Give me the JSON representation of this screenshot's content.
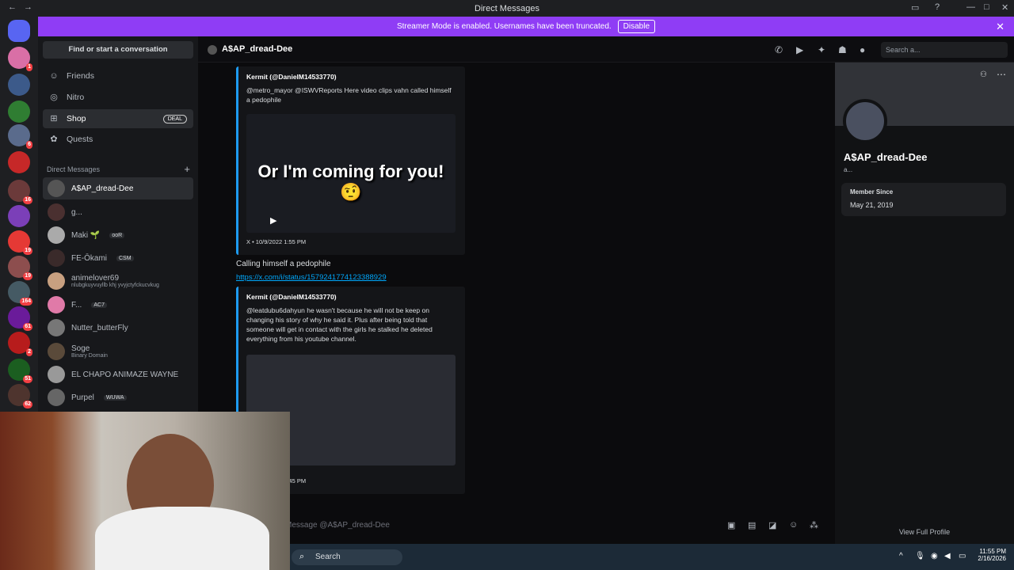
{
  "window": {
    "title": "Direct Messages"
  },
  "banner": {
    "text": "Streamer Mode is enabled. Usernames have been truncated.",
    "button": "Disable"
  },
  "sidebar": {
    "find": "Find or start a conversation",
    "nav": [
      {
        "label": "Friends",
        "icon": "friends-icon"
      },
      {
        "label": "Nitro",
        "icon": "nitro-icon"
      },
      {
        "label": "Shop",
        "icon": "shop-icon",
        "badge": "DEAL"
      },
      {
        "label": "Quests",
        "icon": "quests-icon"
      }
    ],
    "dm_header": "Direct Messages",
    "dms": [
      {
        "name": "A$AP_dread-Dee"
      },
      {
        "name": "g..."
      },
      {
        "name": "Maki 🌱",
        "tag": "ooR"
      },
      {
        "name": "FE-Ōkami",
        "tag": "CSM"
      },
      {
        "name": "animelover69",
        "sub": "nlubgkuyvuyllb khj yvyjctyfckucvkug"
      },
      {
        "name": "F...",
        "tag": "AC7"
      },
      {
        "name": "Nutter_butterFly"
      },
      {
        "name": "Soge",
        "sub": "Binary Domain"
      },
      {
        "name": "EL CHAPO ANIMAZE WAYNE"
      },
      {
        "name": "Purpel",
        "tag": "WUWA"
      }
    ]
  },
  "chat": {
    "name": "A$AP_dread-Dee",
    "search_placeholder": "Search a...",
    "message_placeholder": "Message @A$AP_dread-Dee",
    "embed1": {
      "author": "Kermit (@DanielM14533770)",
      "text": "@metro_mayor @ISWVReports Here video clips vahn called himself a pedophile",
      "overlay": "Or I'm coming for you! 🤨",
      "footer": "X • 10/9/2022 1:55 PM"
    },
    "caption": "Calling himself a pedophile",
    "link": "https://x.com/i/status/1579241774123388929",
    "embed2": {
      "author": "Kermit (@DanielM14533770)",
      "text": "@leatdubu6dahyun he wasn't because he will not be keep on changing his story of why he said it. Plus after being told that someone will get in contact with the girls he stalked he deleted everything from his youtube channel.",
      "footer": "X • 10/9/2022 6:45 PM"
    }
  },
  "profile": {
    "name": "A$AP_dread-Dee",
    "sub": "a...",
    "member_since_label": "Member Since",
    "member_since": "May 21, 2019",
    "view_full": "View Full Profile"
  },
  "taskbar": {
    "search": "Search",
    "time": "11:55 PM",
    "date": "2/16/2026"
  }
}
